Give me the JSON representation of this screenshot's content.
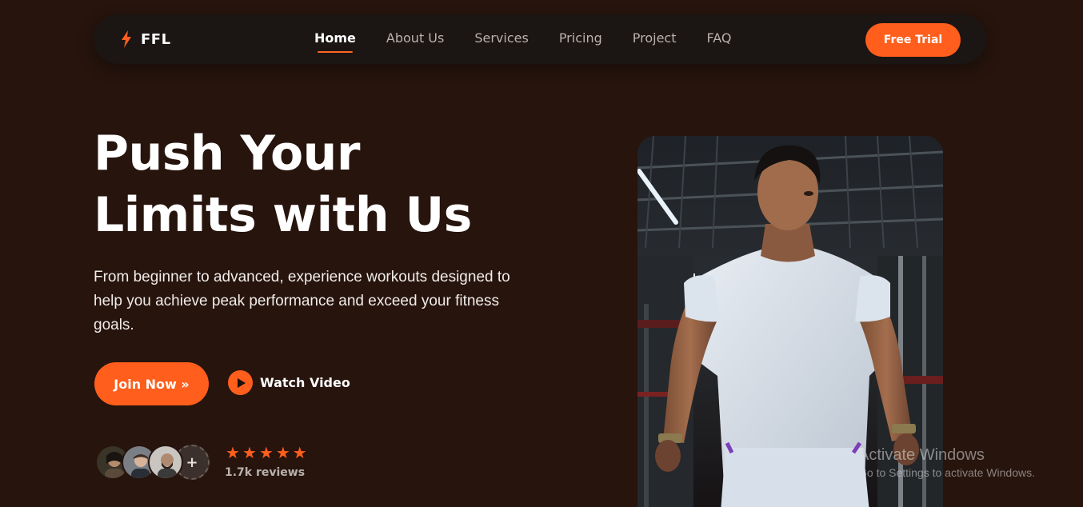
{
  "brand": {
    "name": "FFL",
    "icon": "bolt-icon",
    "accent": "#ff5e1c"
  },
  "nav": {
    "links": [
      {
        "label": "Home",
        "active": true
      },
      {
        "label": "About Us"
      },
      {
        "label": "Services"
      },
      {
        "label": "Pricing"
      },
      {
        "label": "Project"
      },
      {
        "label": "FAQ"
      }
    ],
    "cta": "Free Trial"
  },
  "hero": {
    "title_line1": "Push Your",
    "title_line2": "Limits with Us",
    "description": "From beginner to advanced, experience workouts designed to help you achieve peak performance and exceed your fitness goals.",
    "primary_button": "Join Now »",
    "secondary_button": "Watch Video",
    "secondary_icon": "play-icon"
  },
  "social_proof": {
    "avatar_more": "+",
    "stars": [
      "★",
      "★",
      "★",
      "★",
      "★"
    ],
    "reviews": "1.7k reviews"
  },
  "watermark": {
    "line1": "Activate Windows",
    "line2": "Go to Settings to activate Windows."
  },
  "colors": {
    "background": "#26140d",
    "navbar": "#1b1513",
    "accent": "#ff5e1c"
  }
}
